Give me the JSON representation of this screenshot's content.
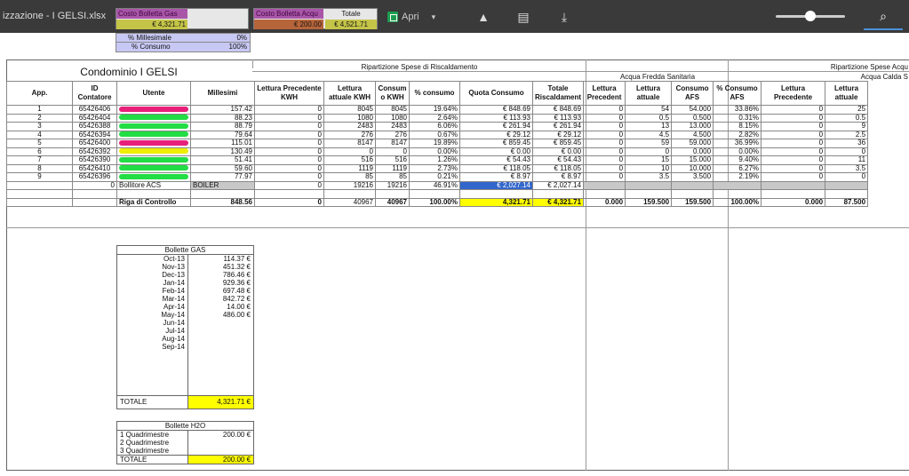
{
  "viewer": {
    "filename": "izzazione - I GELSI.xlsx",
    "open_label": "Apri"
  },
  "peek": {
    "costo_gas_label": "Costo Bolletta Gas",
    "costo_gas_value": "€ 4,321.71",
    "costo_acqua_label": "Costo Bolletta Acqu",
    "costo_acqua_value": "€ 200.00",
    "totale_label": "Totale",
    "totale_value": "€ 4,521.71",
    "millesimale_label": "% Millesimale",
    "millesimale_value": "0%",
    "consumo_label": "% Consumo",
    "consumo_value": "100%"
  },
  "sheet": {
    "title": "Condominio I GELSI",
    "group_riscaldamento": "Ripartizione Spese di Riscaldamento",
    "group_afs": "Acqua Fredda Sanitaria",
    "group_acqua": "Ripartizione Spese Acqu",
    "group_acs": "Acqua Calda S",
    "headers": [
      "App.",
      "ID Contatore",
      "Utente",
      "Millesimi",
      "Lettura Precedente KWH",
      "Lettura attuale KWH",
      "Consum o KWH",
      "% consumo",
      "Quota Consumo",
      "Totale Riscaldament",
      "Lettura Precedent",
      "Lettura attuale",
      "Consumo AFS",
      "% Consumo AFS",
      "Lettura Precedente",
      "Lettura attuale"
    ],
    "rows": [
      {
        "app": "1",
        "id": "65426406",
        "mark": "#e8207a",
        "mill": "157.42",
        "lp": "0",
        "la": "8045",
        "cons": "8045",
        "pct": "19.64%",
        "quota": "€ 848.69",
        "tot": "€ 848.69",
        "afs_lp": "0",
        "afs_la": "54",
        "afs_c": "54.000",
        "afs_pct": "33.86%",
        "acs_lp": "0",
        "acs_la": "25"
      },
      {
        "app": "2",
        "id": "65426404",
        "mark": "#22dd44",
        "mill": "88.23",
        "lp": "0",
        "la": "1080",
        "cons": "1080",
        "pct": "2.64%",
        "quota": "€ 113.93",
        "tot": "€ 113.93",
        "afs_lp": "0",
        "afs_la": "0.5",
        "afs_c": "0.500",
        "afs_pct": "0.31%",
        "acs_lp": "0",
        "acs_la": "0.5"
      },
      {
        "app": "3",
        "id": "65426388",
        "mark": "#22dd44",
        "mill": "88.79",
        "lp": "0",
        "la": "2483",
        "cons": "2483",
        "pct": "6.06%",
        "quota": "€ 261.94",
        "tot": "€ 261.94",
        "afs_lp": "0",
        "afs_la": "13",
        "afs_c": "13.000",
        "afs_pct": "8.15%",
        "acs_lp": "0",
        "acs_la": "9"
      },
      {
        "app": "4",
        "id": "65426394",
        "mark": "#22dd44",
        "mill": "79.64",
        "lp": "0",
        "la": "276",
        "cons": "276",
        "pct": "0.67%",
        "quota": "€ 29.12",
        "tot": "€ 29.12",
        "afs_lp": "0",
        "afs_la": "4.5",
        "afs_c": "4.500",
        "afs_pct": "2.82%",
        "acs_lp": "0",
        "acs_la": "2.5"
      },
      {
        "app": "5",
        "id": "65426400",
        "mark": "#e8207a",
        "mill": "115.01",
        "lp": "0",
        "la": "8147",
        "cons": "8147",
        "pct": "19.89%",
        "quota": "€ 859.45",
        "tot": "€ 859.45",
        "afs_lp": "0",
        "afs_la": "59",
        "afs_c": "59.000",
        "afs_pct": "36.99%",
        "acs_lp": "0",
        "acs_la": "36"
      },
      {
        "app": "6",
        "id": "65426392",
        "mark": "#eeee00",
        "mill": "130.49",
        "lp": "0",
        "la": "0",
        "cons": "0",
        "pct": "0.00%",
        "quota": "€ 0.00",
        "tot": "€ 0.00",
        "afs_lp": "0",
        "afs_la": "0",
        "afs_c": "0.000",
        "afs_pct": "0.00%",
        "acs_lp": "0",
        "acs_la": "0"
      },
      {
        "app": "7",
        "id": "65426390",
        "mark": "#22dd44",
        "mill": "51.41",
        "lp": "0",
        "la": "516",
        "cons": "516",
        "pct": "1.26%",
        "quota": "€ 54.43",
        "tot": "€ 54.43",
        "afs_lp": "0",
        "afs_la": "15",
        "afs_c": "15.000",
        "afs_pct": "9.40%",
        "acs_lp": "0",
        "acs_la": "11"
      },
      {
        "app": "8",
        "id": "65426410",
        "mark": "#22dd44",
        "mill": "59.60",
        "lp": "0",
        "la": "1119",
        "cons": "1119",
        "pct": "2.73%",
        "quota": "€ 118.05",
        "tot": "€ 118.05",
        "afs_lp": "0",
        "afs_la": "10",
        "afs_c": "10.000",
        "afs_pct": "6.27%",
        "acs_lp": "0",
        "acs_la": "3.5"
      },
      {
        "app": "9",
        "id": "65426396",
        "mark": "#22dd44",
        "mill": "77.97",
        "lp": "0",
        "la": "85",
        "cons": "85",
        "pct": "0.21%",
        "quota": "€ 8.97",
        "tot": "€ 8.97",
        "afs_lp": "0",
        "afs_la": "3.5",
        "afs_c": "3.500",
        "afs_pct": "2.19%",
        "acs_lp": "0",
        "acs_la": "0"
      }
    ],
    "boiler": {
      "id": "0",
      "name": "Bollitore ACS",
      "tag": "BOILER",
      "lp": "0",
      "la": "19216",
      "cons": "19216",
      "pct": "46.91%",
      "quota": "€ 2,027.14",
      "tot": "€ 2,027.14"
    },
    "control": {
      "label": "Riga di Controllo",
      "mill": "848.56",
      "lp": "0",
      "la": "40967",
      "cons": "40967",
      "pct": "100.00%",
      "quota": "4,321.71",
      "tot": "€ 4,321.71",
      "afs_lp": "0.000",
      "afs_la": "159.500",
      "afs_c": "159.500",
      "afs_pct": "100.00%",
      "acs_lp": "0.000",
      "acs_la": "87.500"
    }
  },
  "gas": {
    "title": "Bollette GAS",
    "items": [
      {
        "month": "Oct-13",
        "value": "114.37 €"
      },
      {
        "month": "Nov-13",
        "value": "451.32 €"
      },
      {
        "month": "Dec-13",
        "value": "786.46 €"
      },
      {
        "month": "Jan-14",
        "value": "929.36 €"
      },
      {
        "month": "Feb-14",
        "value": "697.48 €"
      },
      {
        "month": "Mar-14",
        "value": "842.72 €"
      },
      {
        "month": "Apr-14",
        "value": "14.00 €"
      },
      {
        "month": "May-14",
        "value": "486.00 €"
      },
      {
        "month": "Jun-14",
        "value": ""
      },
      {
        "month": "Jul-14",
        "value": ""
      },
      {
        "month": "Aug-14",
        "value": ""
      },
      {
        "month": "Sep-14",
        "value": ""
      }
    ],
    "total_label": "TOTALE",
    "total_value": "4,321.71 €"
  },
  "h2o": {
    "title": "Bollette H2O",
    "items": [
      {
        "label": "1 Quadrimestre",
        "value": "200.00 €"
      },
      {
        "label": "2 Quadrimestre",
        "value": ""
      },
      {
        "label": "3 Quadrimestre",
        "value": ""
      }
    ],
    "total_label": "TOTALE",
    "total_value": "200.00 €"
  },
  "colors": {
    "highlight_yellow": "#ffff00",
    "highlight_blue": "#3366cc",
    "topbar": "#3a3a3a"
  }
}
